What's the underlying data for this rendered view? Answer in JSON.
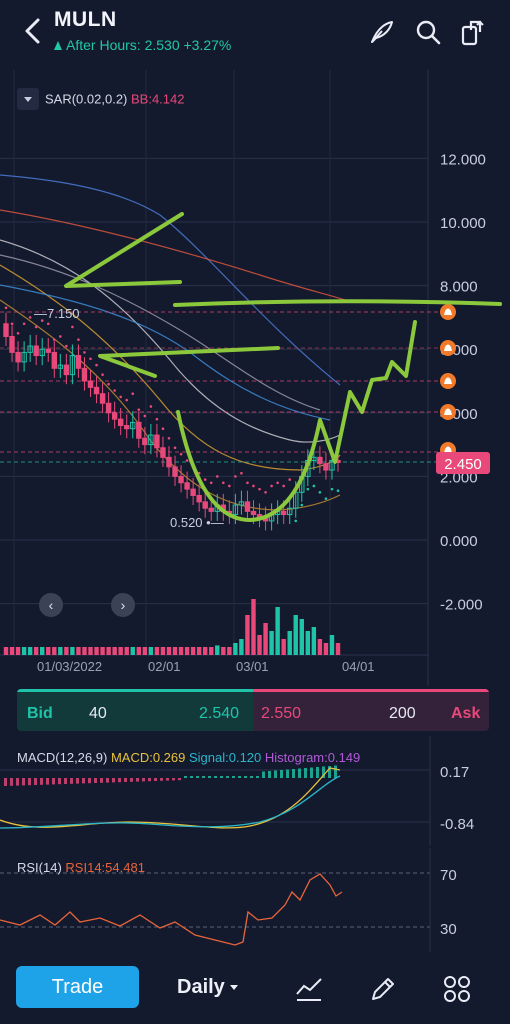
{
  "header": {
    "ticker": "MULN",
    "after_hours": "After Hours: 2.530 +3.27%"
  },
  "indicators": {
    "sar_label": "SAR(0.02,0.2)",
    "bb_label": "BB:4.142"
  },
  "colors": {
    "background": "#141a2e",
    "up": "#1fc4a8",
    "down": "#e8497a",
    "accent": "#1fa3e8",
    "annotation": "#8bc83c"
  },
  "chart_data": [
    {
      "type": "candlestick",
      "y_ticks": [
        "12.000",
        "10.000",
        "8.000",
        "6.000",
        "4.000",
        "2.000",
        "0.000",
        "-2.000"
      ],
      "x_ticks": [
        "01/03/2022",
        "02/01",
        "03/01",
        "04/01"
      ],
      "ylim": [
        -3,
        13
      ],
      "annotations": {
        "high_marker": "7.150",
        "low_marker": "0.520"
      },
      "price_label": "2.450",
      "close": [
        6.4,
        5.9,
        5.6,
        5.9,
        6.1,
        5.8,
        6.0,
        5.9,
        5.4,
        5.5,
        5.2,
        5.8,
        5.4,
        5.0,
        4.8,
        4.6,
        4.3,
        4.0,
        3.8,
        3.6,
        3.5,
        3.7,
        3.2,
        3.0,
        3.3,
        2.9,
        2.6,
        2.3,
        2.0,
        1.8,
        1.6,
        1.4,
        1.2,
        1.0,
        0.9,
        1.1,
        0.9,
        0.8,
        1.1,
        1.2,
        0.9,
        0.8,
        0.7,
        0.6,
        0.8,
        0.9,
        0.8,
        1.0,
        1.5,
        2.0,
        2.5,
        2.6,
        2.4,
        2.2,
        2.5,
        2.45
      ],
      "volume": [
        0.1,
        0.1,
        0.1,
        0.1,
        0.1,
        0.1,
        0.1,
        0.1,
        0.1,
        0.1,
        0.1,
        0.1,
        0.1,
        0.1,
        0.1,
        0.1,
        0.1,
        0.1,
        0.1,
        0.1,
        0.1,
        0.1,
        0.1,
        0.1,
        0.1,
        0.1,
        0.1,
        0.1,
        0.1,
        0.1,
        0.1,
        0.1,
        0.1,
        0.1,
        0.1,
        0.12,
        0.1,
        0.1,
        0.15,
        0.2,
        0.5,
        0.7,
        0.25,
        0.4,
        0.3,
        0.6,
        0.2,
        0.3,
        0.5,
        0.45,
        0.3,
        0.35,
        0.2,
        0.15,
        0.25,
        0.15
      ]
    },
    {
      "type": "line",
      "title": "MACD(12,26,9)",
      "values_text": {
        "macd": "MACD:0.269",
        "signal": "Signal:0.120",
        "histogram": "Histogram:0.149"
      },
      "y_ticks": [
        "0.17",
        "-0.84"
      ]
    },
    {
      "type": "line",
      "title": "RSI(14)",
      "value_text": "RSI14:54.481",
      "y_ticks": [
        "70",
        "30"
      ]
    }
  ],
  "quote": {
    "bid_label": "Bid",
    "bid_size": "40",
    "bid_price": "2.540",
    "ask_price": "2.550",
    "ask_size": "200",
    "ask_label": "Ask"
  },
  "bottom": {
    "trade": "Trade",
    "period": "Daily"
  },
  "icons": [
    "back-icon",
    "draw-icon",
    "search-icon",
    "share-icon",
    "indicator-icon",
    "pen-icon",
    "grid-icon",
    "alert-bell-icon"
  ]
}
